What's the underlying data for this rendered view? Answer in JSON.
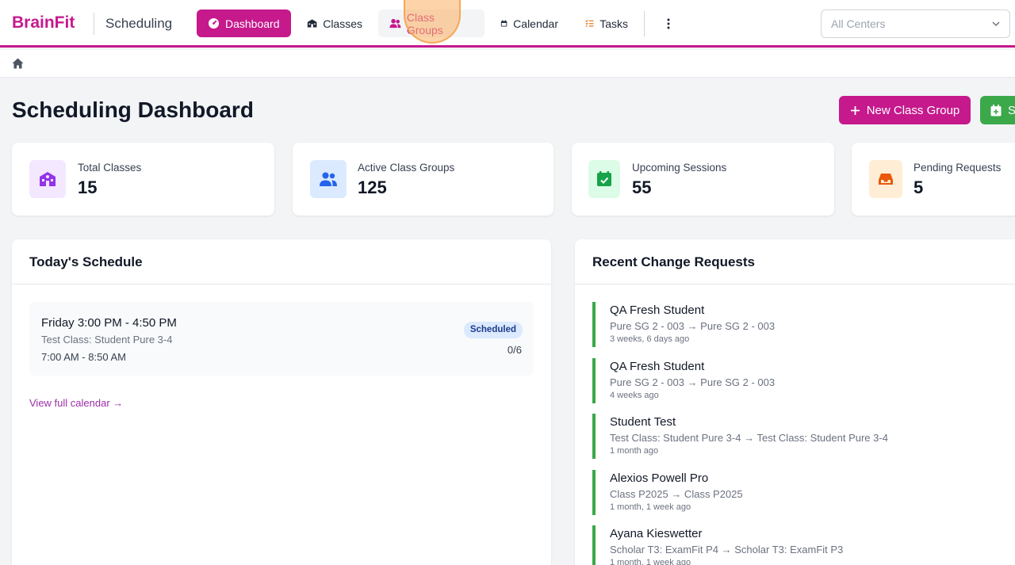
{
  "app": {
    "brand": "BrainFit",
    "section": "Scheduling"
  },
  "nav": {
    "dashboard": "Dashboard",
    "classes": "Classes",
    "class_groups": "Class Groups",
    "calendar": "Calendar",
    "tasks": "Tasks"
  },
  "center_select": {
    "value": "All Centers"
  },
  "page": {
    "title": "Scheduling Dashboard",
    "new_group_button": "New Class Group",
    "green_button": "S"
  },
  "stats": [
    {
      "label": "Total Classes",
      "value": "15"
    },
    {
      "label": "Active Class Groups",
      "value": "125"
    },
    {
      "label": "Upcoming Sessions",
      "value": "55"
    },
    {
      "label": "Pending Requests",
      "value": "5"
    }
  ],
  "today": {
    "title": "Today's Schedule",
    "item": {
      "time": "Friday 3:00 PM - 4:50 PM",
      "class": "Test Class: Student Pure 3-4",
      "alt_time": "7:00 AM - 8:50 AM",
      "status": "Scheduled",
      "count": "0/6"
    },
    "link": "View full calendar →"
  },
  "requests": {
    "title": "Recent Change Requests",
    "items": [
      {
        "name": "QA Fresh Student",
        "change": "Pure SG 2 - 003 → Pure SG 2 - 003",
        "time": "3 weeks, 6 days ago"
      },
      {
        "name": "QA Fresh Student",
        "change": "Pure SG 2 - 003 → Pure SG 2 - 003",
        "time": "4 weeks ago"
      },
      {
        "name": "Student Test",
        "change": "Test Class: Student Pure 3-4 → Test Class: Student Pure 3-4",
        "time": "1 month ago"
      },
      {
        "name": "Alexios Powell Pro",
        "change": "Class P2025 → Class P2025",
        "time": "1 month, 1 week ago"
      },
      {
        "name": "Ayana Kieswetter",
        "change": "Scholar T3: ExamFit P4 → Scholar T3: ExamFit P3",
        "time": "1 month, 1 week ago"
      }
    ]
  },
  "colors": {
    "brand": "#c5198c",
    "success": "#3ba84a",
    "badge_bg": "#dbeafe"
  }
}
